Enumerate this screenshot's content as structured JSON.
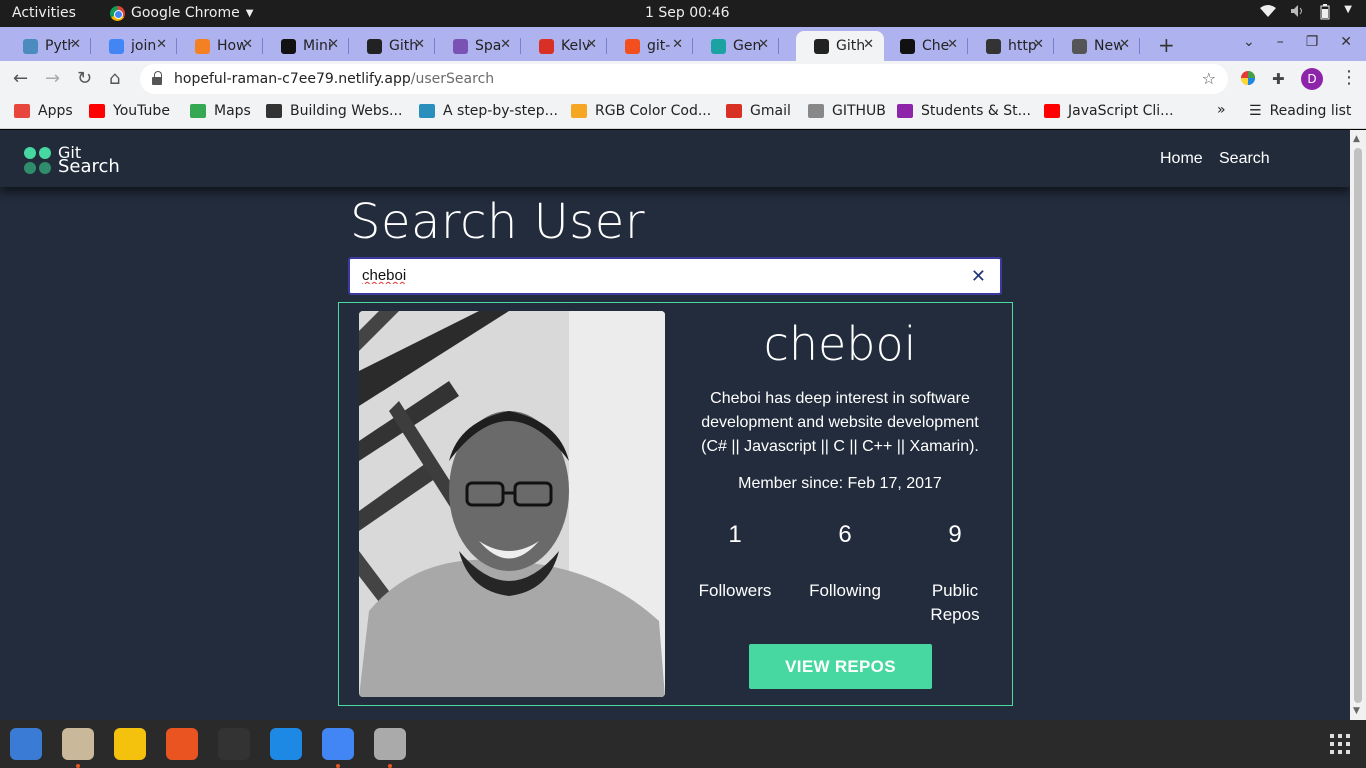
{
  "system": {
    "activities": "Activities",
    "app_name": "Google Chrome",
    "clock": "1 Sep  00:46"
  },
  "tabs": [
    {
      "title": "Pyth",
      "icon": "python-icon",
      "color": "#4b8bbe"
    },
    {
      "title": "join",
      "icon": "google-icon",
      "color": "#4285f4"
    },
    {
      "title": "How",
      "icon": "stackoverflow-icon",
      "color": "#f48024"
    },
    {
      "title": "Mini",
      "icon": "hn-icon",
      "color": "#111111"
    },
    {
      "title": "Gith",
      "icon": "angular-icon",
      "color": "#222222"
    },
    {
      "title": "Spa",
      "icon": "bootstrap-icon",
      "color": "#7952b3"
    },
    {
      "title": "Kelv",
      "icon": "gmail-icon",
      "color": "#d93025"
    },
    {
      "title": "git-",
      "icon": "figma-icon",
      "color": "#f24e1e"
    },
    {
      "title": "Gen",
      "icon": "diamond-icon",
      "color": "#1ba3a3"
    },
    {
      "title": "Gith",
      "icon": "angular-icon",
      "color": "#222222",
      "active": true
    },
    {
      "title": "Che",
      "icon": "github-icon",
      "color": "#111111"
    },
    {
      "title": "http",
      "icon": "globe-icon",
      "color": "#333333"
    },
    {
      "title": "New",
      "icon": "chrome-icon",
      "color": "#555555"
    }
  ],
  "address": {
    "host": "hopeful-raman-c7ee79.netlify.app",
    "path": "/userSearch"
  },
  "bookmarks": [
    {
      "label": "Apps",
      "icon": "apps-grid-icon",
      "color": "#e8453c"
    },
    {
      "label": "YouTube",
      "icon": "youtube-icon",
      "color": "#ff0000"
    },
    {
      "label": "Maps",
      "icon": "maps-pin-icon",
      "color": "#34a853"
    },
    {
      "label": "Building Webs...",
      "icon": "globe-icon",
      "color": "#333333"
    },
    {
      "label": "A step-by-step...",
      "icon": "pattern-icon",
      "color": "#2a8fbd"
    },
    {
      "label": "RGB Color Cod...",
      "icon": "r-icon",
      "color": "#f5a623"
    },
    {
      "label": "Gmail",
      "icon": "gmail-icon",
      "color": "#d93025"
    },
    {
      "label": "GITHUB",
      "icon": "tree-icon",
      "color": "#888888"
    },
    {
      "label": "Students & St...",
      "icon": "list-icon",
      "color": "#8e24aa"
    },
    {
      "label": "JavaScript Cli...",
      "icon": "youtube-icon",
      "color": "#ff0000"
    }
  ],
  "bookmarks_more": "»",
  "reading_list": "Reading list",
  "profile_initial": "D",
  "site": {
    "logo_line1": "Git",
    "logo_line2": "Search",
    "nav": [
      "Home",
      "Search"
    ],
    "heading": "Search User",
    "search_value": "cheboi",
    "accent": "#47d7a1",
    "background": "#222c3c"
  },
  "profile": {
    "username": "cheboi",
    "bio": "Cheboi has deep interest in software development and website development (C# || Javascript || C || C++ || Xamarin).",
    "member_since": "Member since: Feb 17, 2017",
    "stats": [
      {
        "value": "1",
        "label": "Followers"
      },
      {
        "value": "6",
        "label": "Following"
      },
      {
        "value": "9",
        "label": "Public Repos"
      }
    ],
    "button": "VIEW REPOS"
  },
  "dock": [
    {
      "icon": "thunderbird-icon",
      "color": "#3a7bd5",
      "running": false
    },
    {
      "icon": "files-icon",
      "color": "#c9b99a",
      "running": true
    },
    {
      "icon": "rhythmbox-icon",
      "color": "#f4c20d",
      "running": false
    },
    {
      "icon": "software-store-icon",
      "color": "#e95420",
      "running": false
    },
    {
      "icon": "terminal-icon",
      "color": "#333333",
      "running": false
    },
    {
      "icon": "vscode-icon",
      "color": "#1e88e5",
      "running": false
    },
    {
      "icon": "chrome-icon",
      "color": "#4285f4",
      "running": true
    },
    {
      "icon": "screenshot-icon",
      "color": "#aaaaaa",
      "running": true
    }
  ]
}
